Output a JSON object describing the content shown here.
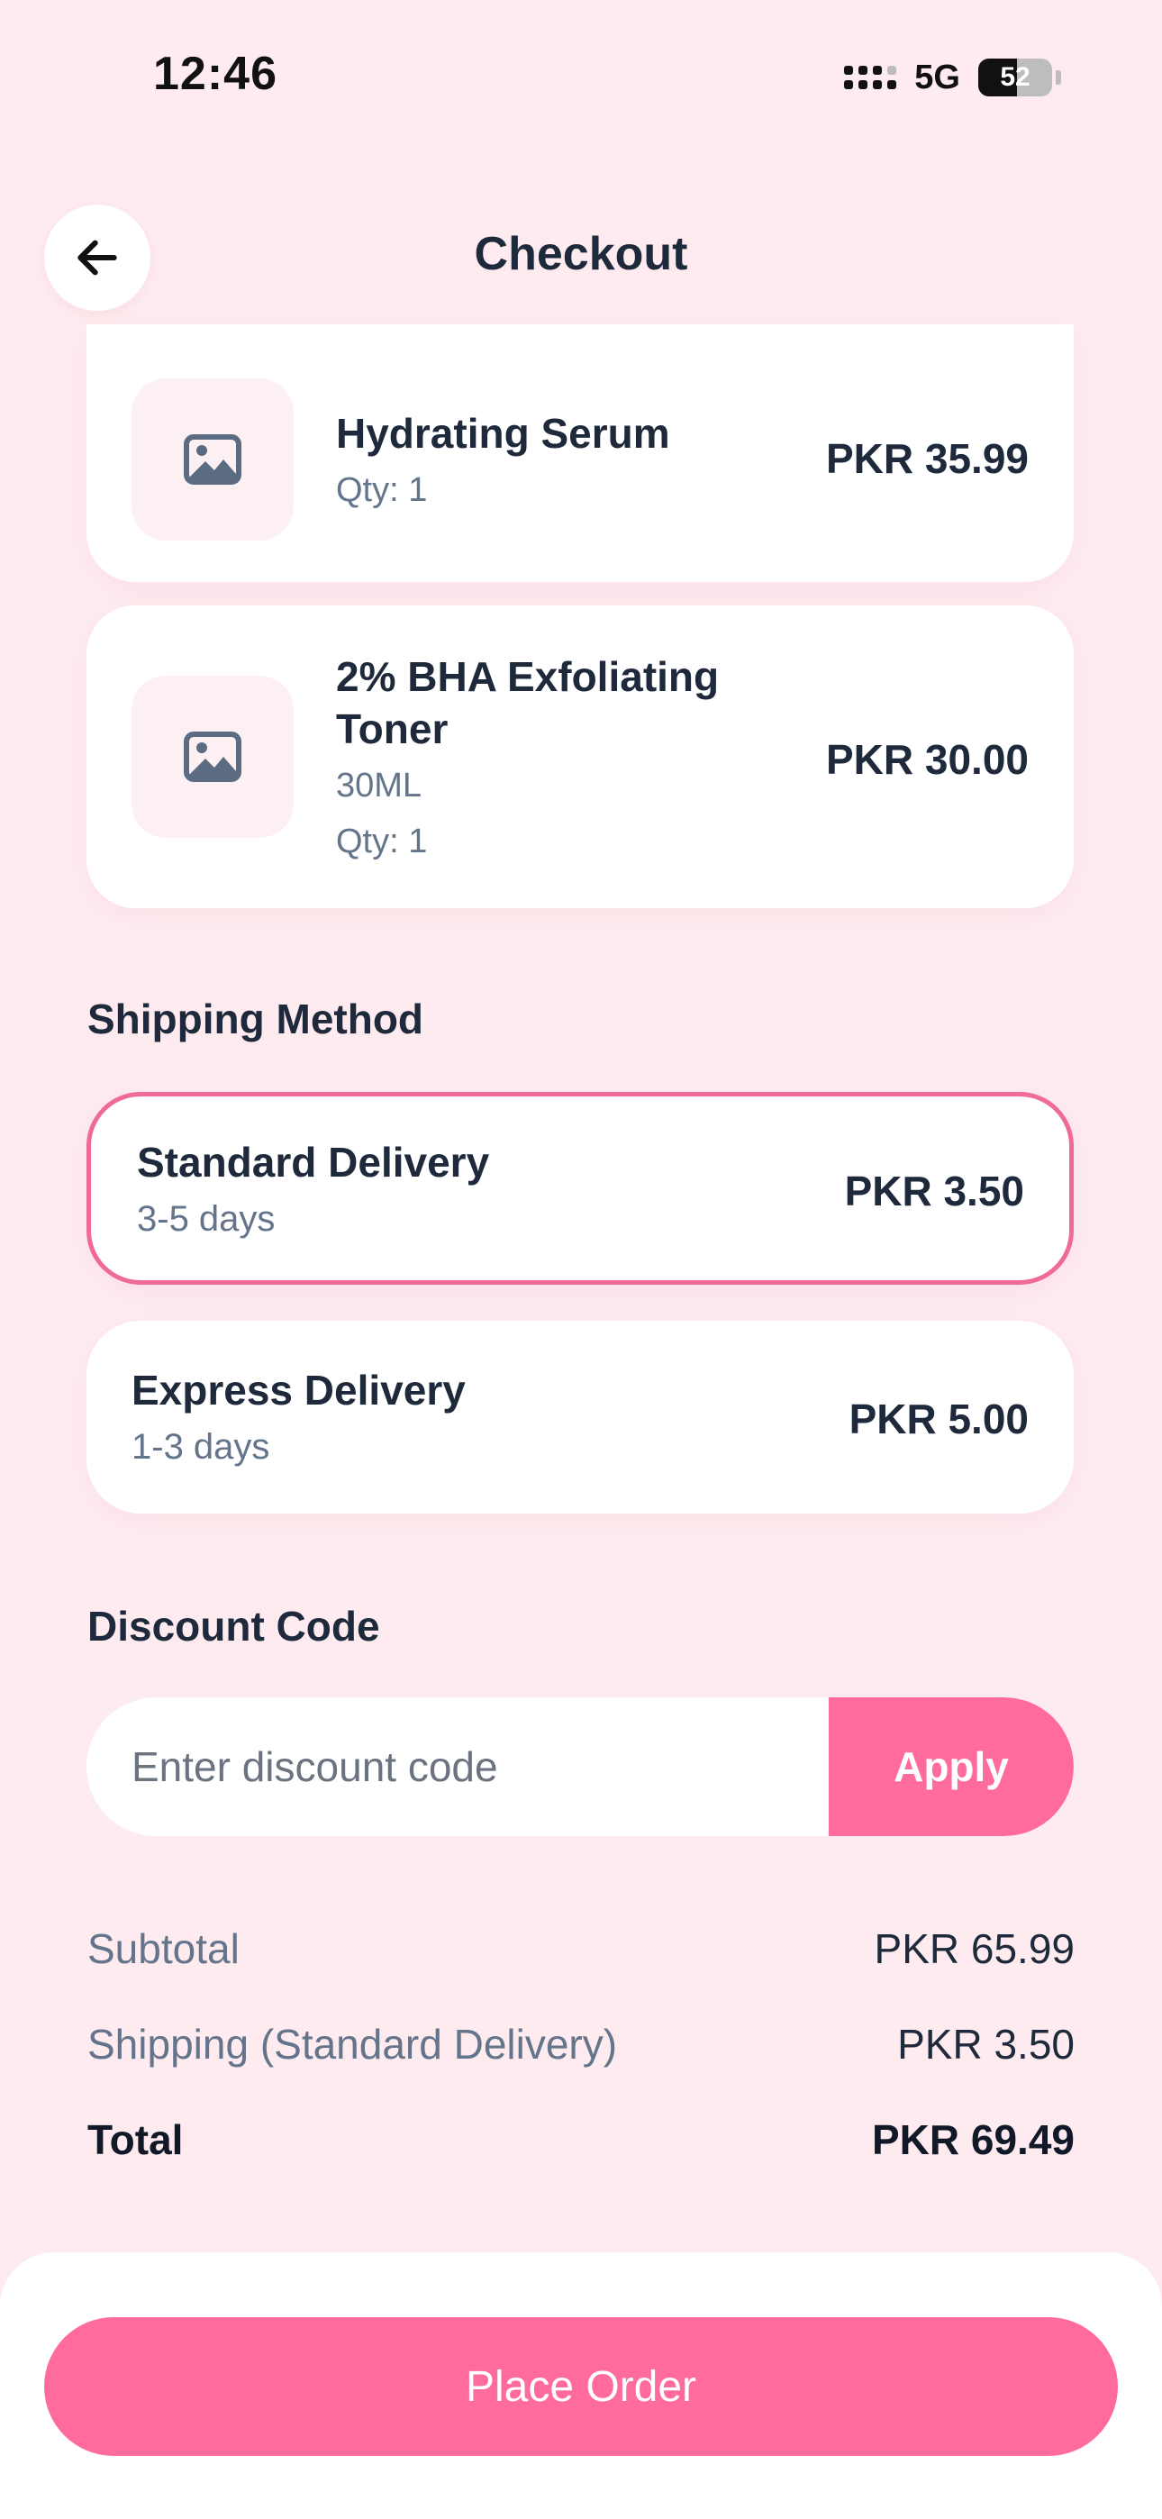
{
  "status_bar": {
    "time": "12:46",
    "network": "5G",
    "battery": "52",
    "battery_level": 0.52
  },
  "header": {
    "title": "Checkout",
    "back_icon": "arrow-left-icon"
  },
  "cart": {
    "items": [
      {
        "name": "Hydrating Serum",
        "variant": "",
        "qty": "Qty: 1",
        "price": "PKR 35.99",
        "image_icon": "image-placeholder-icon"
      },
      {
        "name": "2% BHA Exfoliating Toner",
        "variant": "30ML",
        "qty": "Qty: 1",
        "price": "PKR 30.00",
        "image_icon": "image-placeholder-icon"
      }
    ]
  },
  "shipping": {
    "title": "Shipping Method",
    "options": [
      {
        "name": "Standard Delivery",
        "days": "3-5 days",
        "price": "PKR 3.50",
        "selected": true
      },
      {
        "name": "Express Delivery",
        "days": "1-3 days",
        "price": "PKR 5.00",
        "selected": false
      }
    ]
  },
  "discount": {
    "title": "Discount Code",
    "placeholder": "Enter discount code",
    "value": "",
    "apply_label": "Apply"
  },
  "summary": {
    "subtotal_label": "Subtotal",
    "subtotal_value": "PKR 65.99",
    "shipping_label": "Shipping (Standard Delivery)",
    "shipping_value": "PKR 3.50",
    "total_label": "Total",
    "total_value": "PKR 69.49"
  },
  "footer": {
    "place_order_label": "Place Order"
  },
  "colors": {
    "background": "#fdebef",
    "accent": "#ff6b9a",
    "selected_border": "#f06a97",
    "text_primary": "#1e293b",
    "text_secondary": "#64748b"
  }
}
